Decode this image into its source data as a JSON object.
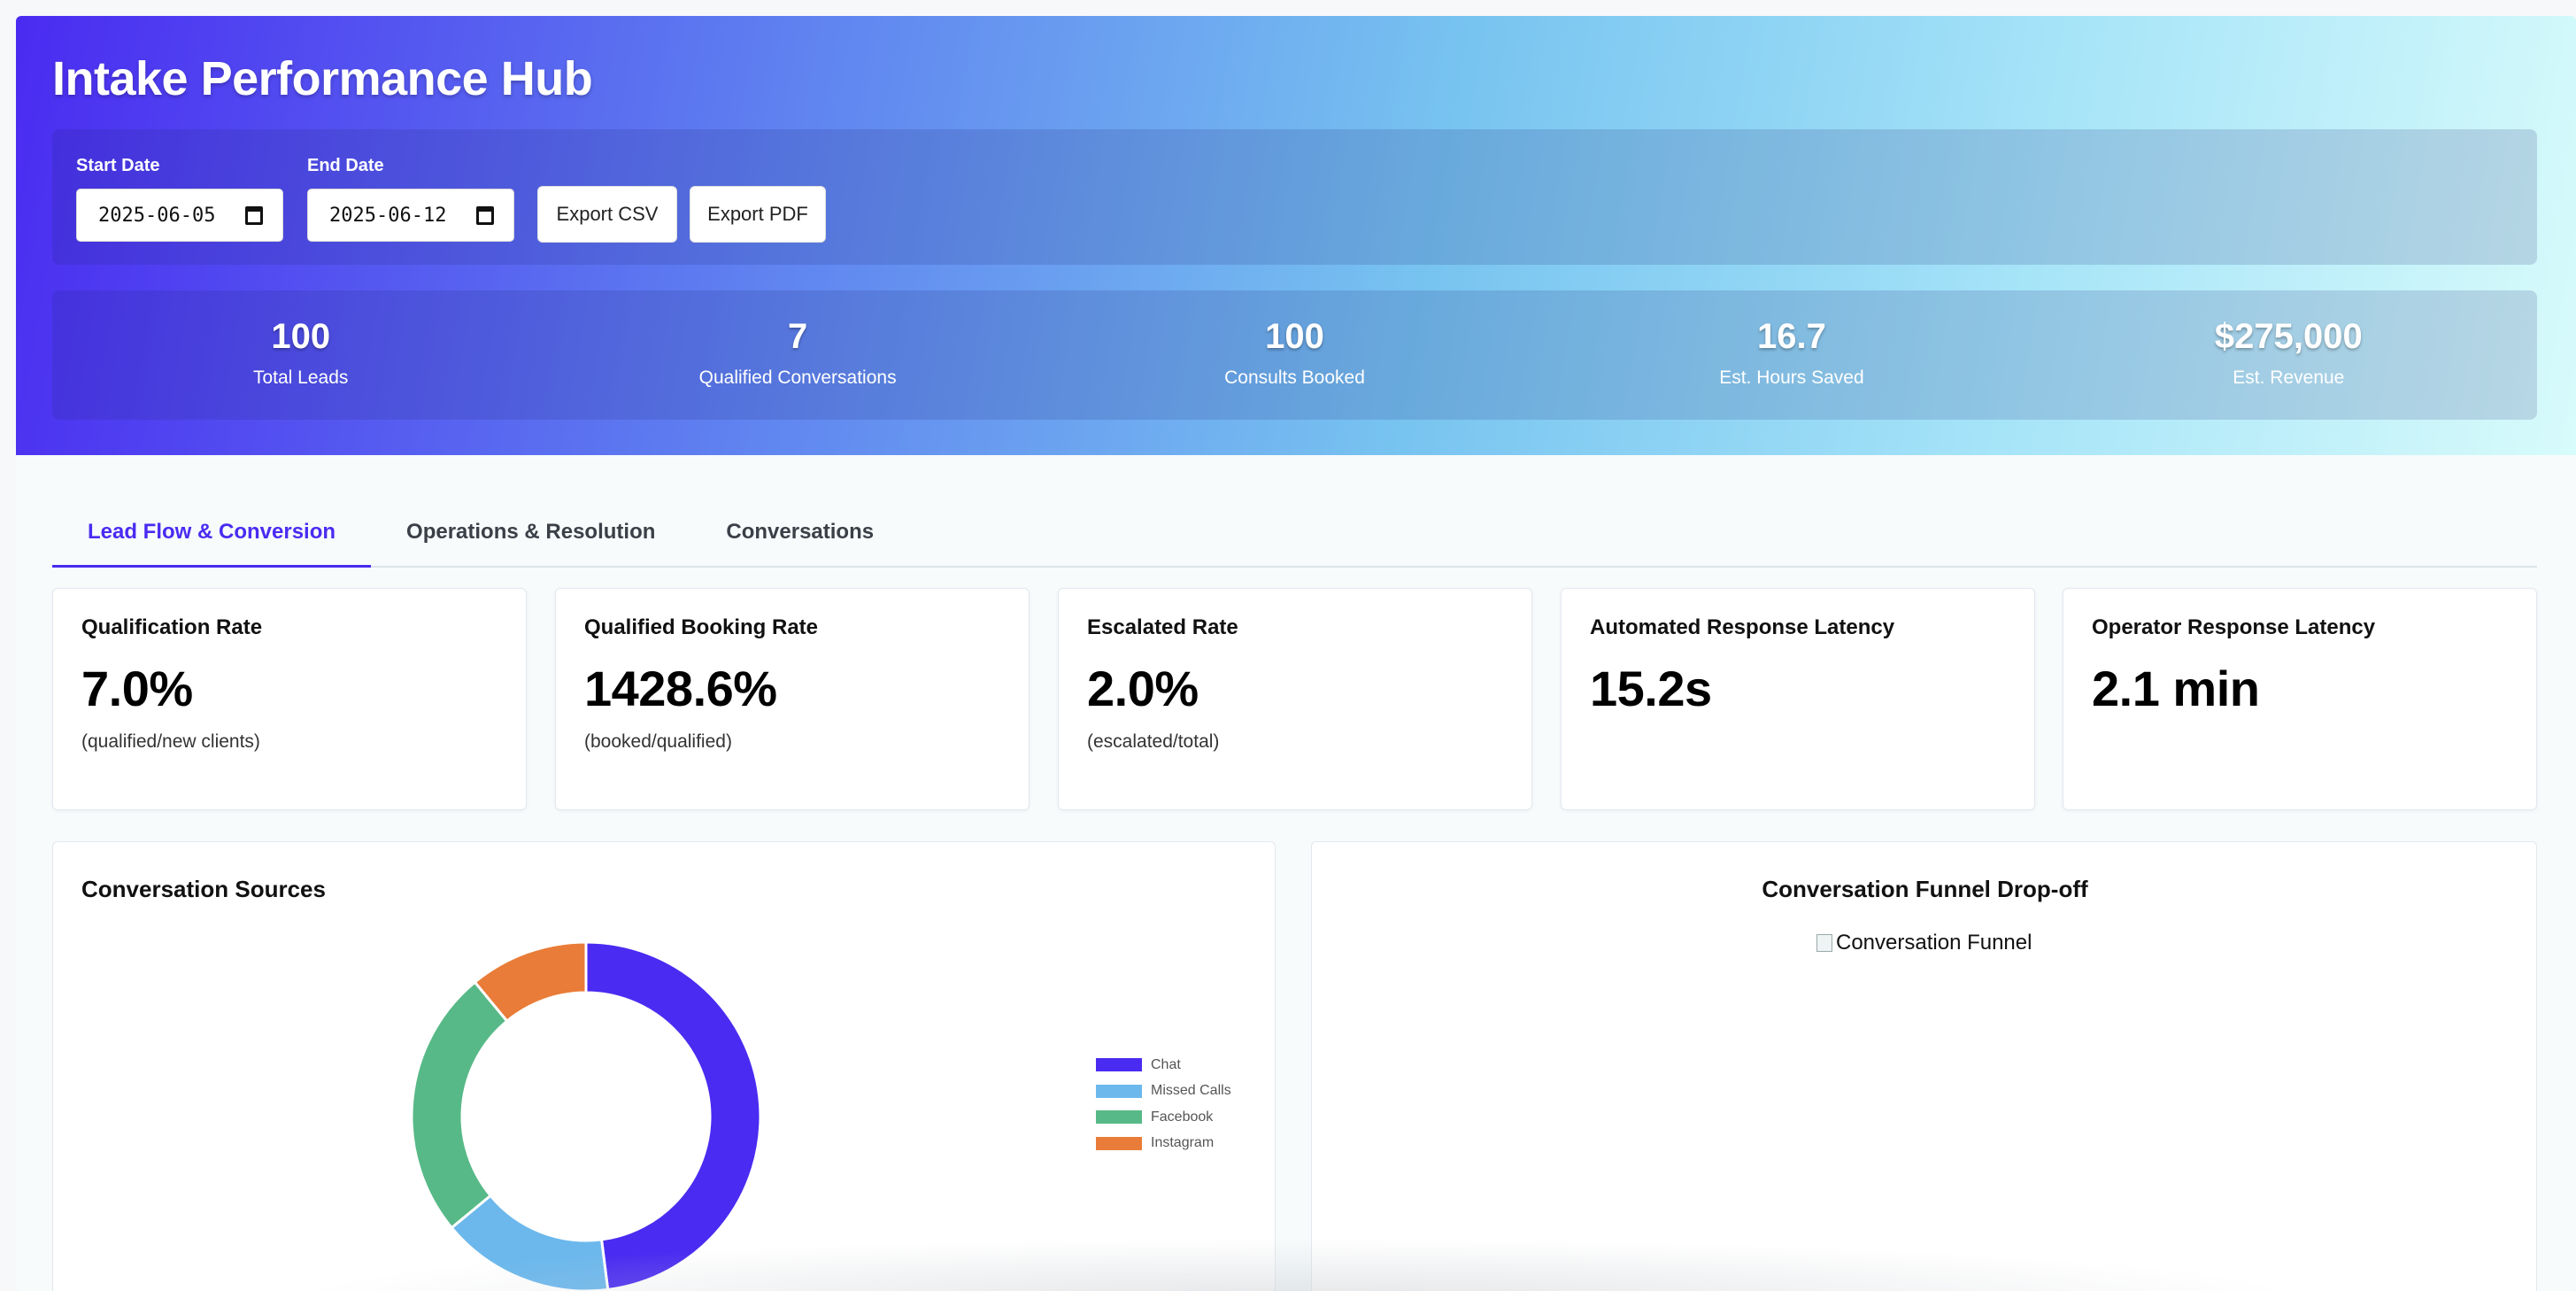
{
  "header": {
    "title": "Intake Performance Hub"
  },
  "filters": {
    "start_label": "Start Date",
    "start_value": "2025-06-05",
    "end_label": "End Date",
    "end_value": "2025-06-12",
    "export_csv": "Export CSV",
    "export_pdf": "Export PDF"
  },
  "stats": [
    {
      "value": "100",
      "label": "Total Leads"
    },
    {
      "value": "7",
      "label": "Qualified Conversations"
    },
    {
      "value": "100",
      "label": "Consults Booked"
    },
    {
      "value": "16.7",
      "label": "Est. Hours Saved"
    },
    {
      "value": "$275,000",
      "label": "Est. Revenue"
    }
  ],
  "tabs": [
    {
      "label": "Lead Flow & Conversion",
      "active": true
    },
    {
      "label": "Operations & Resolution",
      "active": false
    },
    {
      "label": "Conversations",
      "active": false
    }
  ],
  "kpis": [
    {
      "title": "Qualification Rate",
      "value": "7.0%",
      "note": "(qualified/new clients)"
    },
    {
      "title": "Qualified Booking Rate",
      "value": "1428.6%",
      "note": "(booked/qualified)"
    },
    {
      "title": "Escalated Rate",
      "value": "2.0%",
      "note": "(escalated/total)"
    },
    {
      "title": "Automated Response Latency",
      "value": "15.2s",
      "note": ""
    },
    {
      "title": "Operator Response Latency",
      "value": "2.1 min",
      "note": ""
    }
  ],
  "sources_panel": {
    "title": "Conversation Sources"
  },
  "funnel_panel": {
    "title": "Conversation Funnel Drop-off",
    "image_alt": "Conversation Funnel"
  },
  "chart_data": {
    "type": "pie",
    "variant": "doughnut",
    "title": "",
    "categories": [
      "Chat",
      "Missed Calls",
      "Facebook",
      "Instagram"
    ],
    "values": [
      48,
      16,
      25,
      11
    ],
    "colors": [
      "#4a2bf1",
      "#6cb8ec",
      "#57b987",
      "#e97c38"
    ],
    "legend_position": "right"
  }
}
